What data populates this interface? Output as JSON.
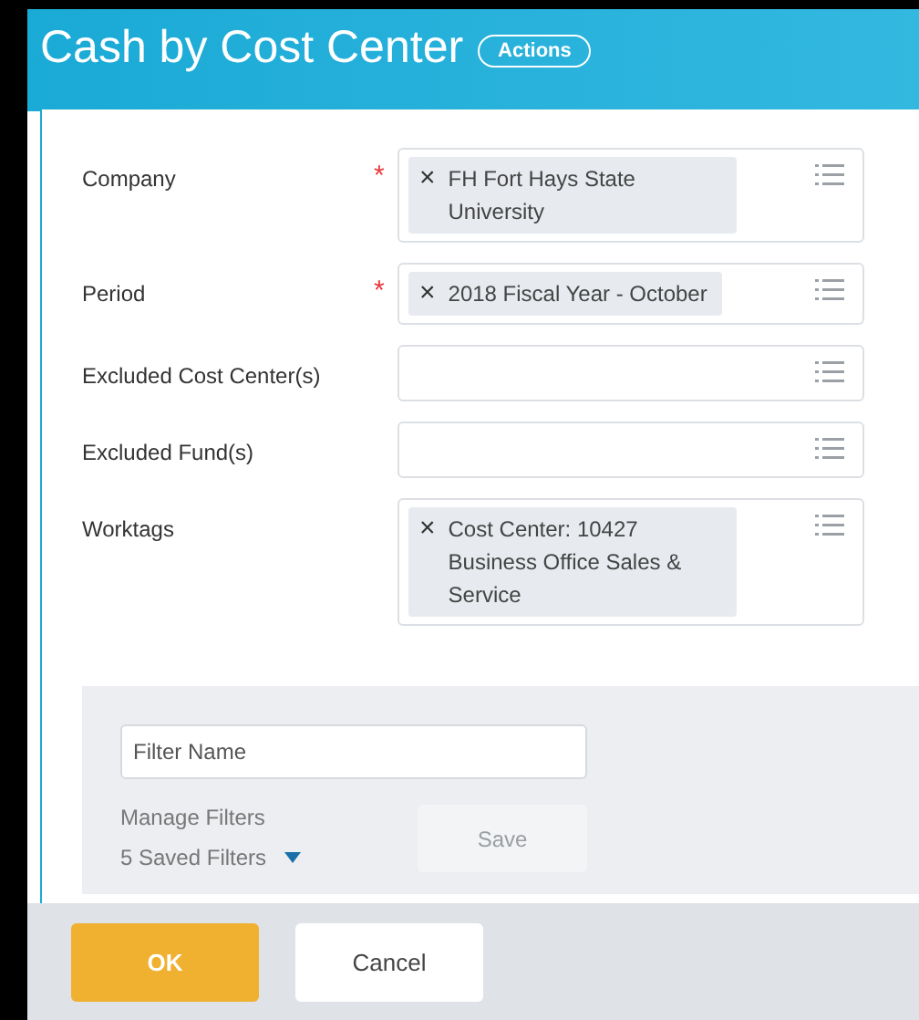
{
  "header": {
    "title": "Cash by Cost Center",
    "actions_button": "Actions"
  },
  "fields": [
    {
      "label": "Company",
      "required": true,
      "values": [
        "FH Fort Hays State University"
      ]
    },
    {
      "label": "Period",
      "required": true,
      "values": [
        "2018 Fiscal Year - October"
      ]
    },
    {
      "label": "Excluded Cost Center(s)",
      "required": false
    },
    {
      "label": "Excluded Fund(s)",
      "required": false
    },
    {
      "label": "Worktags",
      "required": false,
      "values": [
        "Cost Center: 10427 Business Office Sales & Service"
      ]
    }
  ],
  "remove_icon": "×",
  "required_mark": "*",
  "filters": {
    "filter_name": {
      "placeholder": "Filter Name"
    },
    "manage_label": "Manage Filters",
    "saved_filters": "5 Saved Filters",
    "save_button": {
      "label": "Save",
      "disabled": true
    }
  },
  "buttons": {
    "ok": "OK",
    "cancel": "Cancel"
  }
}
